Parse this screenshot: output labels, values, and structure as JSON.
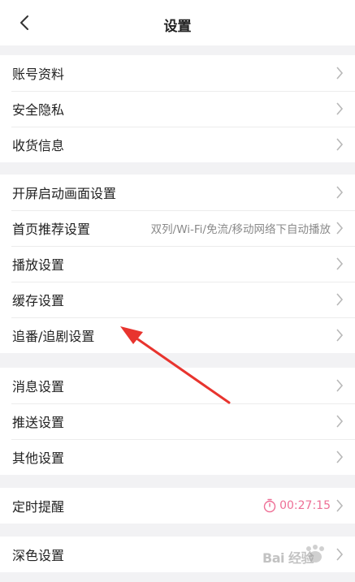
{
  "header": {
    "title": "设置",
    "back_icon": "chevron-left-icon"
  },
  "groups": [
    {
      "items": [
        {
          "label": "账号资料"
        },
        {
          "label": "安全隐私"
        },
        {
          "label": "收货信息"
        }
      ]
    },
    {
      "items": [
        {
          "label": "开屏启动画面设置"
        },
        {
          "label": "首页推荐设置",
          "value": "双列/Wi-Fi/免流/移动网络下自动播放"
        },
        {
          "label": "播放设置"
        },
        {
          "label": "缓存设置"
        },
        {
          "label": "追番/追剧设置"
        }
      ]
    },
    {
      "items": [
        {
          "label": "消息设置"
        },
        {
          "label": "推送设置"
        },
        {
          "label": "其他设置"
        }
      ]
    },
    {
      "items": [
        {
          "label": "定时提醒",
          "value": "00:27:15",
          "icon": "timer-icon"
        }
      ]
    },
    {
      "items": [
        {
          "label": "深色设置"
        }
      ]
    }
  ],
  "colors": {
    "accent": "#ee6f96",
    "annotation": "#e8342e",
    "background": "#f2f2f4"
  },
  "watermark": {
    "text": "Bai 经验"
  }
}
